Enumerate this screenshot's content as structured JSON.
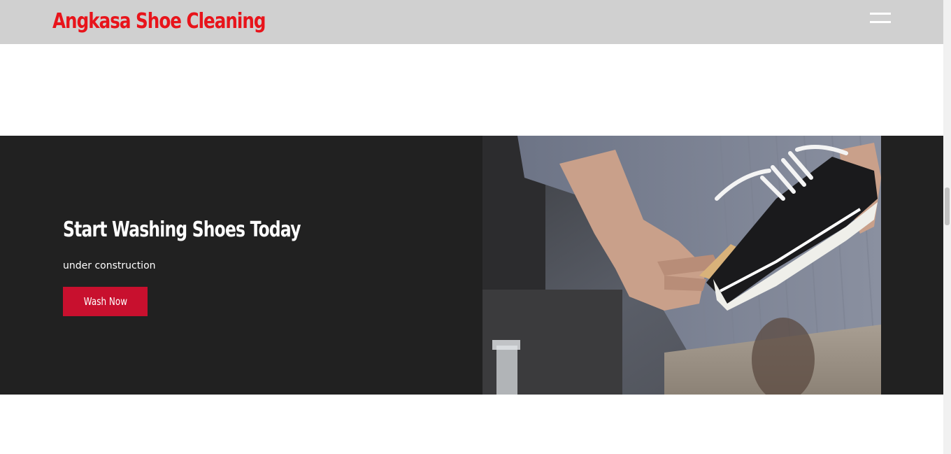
{
  "header": {
    "brand": "Angkasa Shoe Cleaning",
    "menu_icon": "hamburger-menu-icon",
    "brand_color": "#e8141b",
    "background": "#d0d0d0"
  },
  "cta": {
    "title": "Start Washing Shoes Today",
    "subtitle": "under construction",
    "button_label": "Wash Now",
    "button_color": "#c8102e",
    "background": "#212121",
    "image_subject": "hands cleaning a black canvas sneaker"
  }
}
